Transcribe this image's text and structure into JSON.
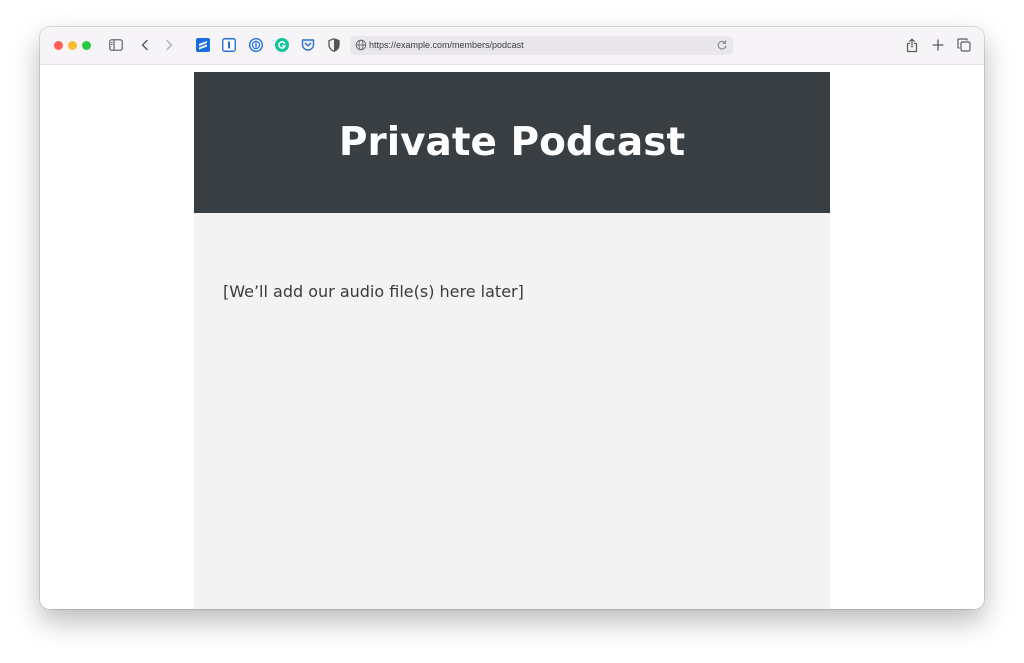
{
  "browser": {
    "url": "https://example.com/members/podcast",
    "colors": {
      "close": "#ff5f57",
      "minimize": "#febc2e",
      "zoom": "#28c840"
    },
    "icons": {
      "sidebar": "sidebar-icon",
      "back": "chevron-left-icon",
      "forward": "chevron-right-icon",
      "share": "share-icon",
      "new_tab": "plus-icon",
      "tabs": "tab-overview-icon",
      "reload": "reload-icon",
      "globe": "globe-icon"
    },
    "extensions": [
      {
        "icon": "stack-extension-icon",
        "color": "#1a6de0"
      },
      {
        "icon": "text-cursor-extension-icon",
        "color": "#2a6fd6"
      },
      {
        "icon": "password-manager-icon",
        "color": "#1e6fe5"
      },
      {
        "icon": "grammar-extension-icon",
        "color": "#15c39a"
      },
      {
        "icon": "pocket-extension-icon",
        "color": "#2a6fd6"
      },
      {
        "icon": "privacy-shield-icon",
        "color": "#555555"
      }
    ]
  },
  "page": {
    "title": "Private Podcast",
    "placeholder": "[We’ll add our audio file(s) here later]",
    "colors": {
      "hero_background": "#393e42",
      "content_background": "#f3f3f3"
    }
  }
}
